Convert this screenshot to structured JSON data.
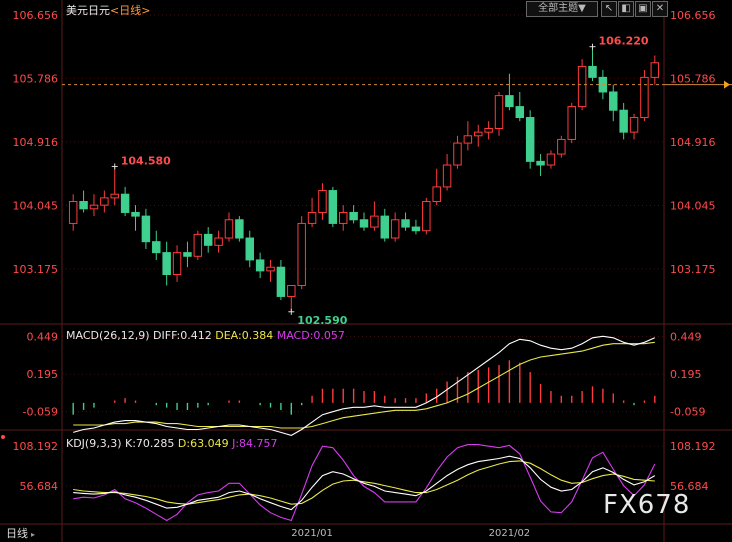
{
  "header": {
    "title": "美元日元",
    "period": "<日线>",
    "theme_button": "全部主题▼",
    "colors": {
      "title": "#e8e8e8",
      "period": "#ff9a3a"
    }
  },
  "macd_header": {
    "name": "MACD(26,12,9)",
    "diff": "DIFF:0.412",
    "dea": "DEA:0.384",
    "macd": "MACD:0.057"
  },
  "kdj_header": {
    "name": "KDJ(9,3,3)",
    "k": "K:70.285",
    "d": "D:63.049",
    "j": "J:84.757"
  },
  "bottom_tab": {
    "label": "日线"
  },
  "watermark": "FX678",
  "colors": {
    "up": "#ff3b3b",
    "down": "#3fcf8e",
    "axis_up": "#ff4b4b",
    "axis_green": "#3fcf8e",
    "diff": "#ffffff",
    "dea": "#e8e84a",
    "jline": "#d63cf0",
    "grid": "#3a1010",
    "dash": "#d08a3a"
  },
  "chart_data": [
    {
      "type": "candlestick",
      "y_ticks": [
        "106.656",
        "105.786",
        "104.916",
        "104.045",
        "103.175"
      ],
      "ylim": [
        102.45,
        106.75
      ],
      "x_labels": [
        "2021/01",
        "2021/02"
      ],
      "annotations": {
        "high": "106.220",
        "high_left": "104.580",
        "low": "102.590"
      },
      "candles": [
        {
          "o": 103.8,
          "h": 104.2,
          "l": 103.7,
          "c": 104.1
        },
        {
          "o": 104.1,
          "h": 104.25,
          "l": 103.95,
          "c": 104.0
        },
        {
          "o": 104.0,
          "h": 104.2,
          "l": 103.9,
          "c": 104.05
        },
        {
          "o": 104.05,
          "h": 104.25,
          "l": 103.95,
          "c": 104.15
        },
        {
          "o": 104.15,
          "h": 104.58,
          "l": 104.05,
          "c": 104.2
        },
        {
          "o": 104.2,
          "h": 104.3,
          "l": 103.9,
          "c": 103.95
        },
        {
          "o": 103.95,
          "h": 104.05,
          "l": 103.7,
          "c": 103.9
        },
        {
          "o": 103.9,
          "h": 104.0,
          "l": 103.45,
          "c": 103.55
        },
        {
          "o": 103.55,
          "h": 103.7,
          "l": 103.3,
          "c": 103.4
        },
        {
          "o": 103.4,
          "h": 103.55,
          "l": 102.95,
          "c": 103.1
        },
        {
          "o": 103.1,
          "h": 103.5,
          "l": 103.0,
          "c": 103.4
        },
        {
          "o": 103.4,
          "h": 103.55,
          "l": 103.2,
          "c": 103.35
        },
        {
          "o": 103.35,
          "h": 103.7,
          "l": 103.3,
          "c": 103.65
        },
        {
          "o": 103.65,
          "h": 103.75,
          "l": 103.4,
          "c": 103.5
        },
        {
          "o": 103.5,
          "h": 103.7,
          "l": 103.4,
          "c": 103.6
        },
        {
          "o": 103.6,
          "h": 103.95,
          "l": 103.55,
          "c": 103.85
        },
        {
          "o": 103.85,
          "h": 103.9,
          "l": 103.55,
          "c": 103.6
        },
        {
          "o": 103.6,
          "h": 103.7,
          "l": 103.2,
          "c": 103.3
        },
        {
          "o": 103.3,
          "h": 103.4,
          "l": 103.05,
          "c": 103.15
        },
        {
          "o": 103.15,
          "h": 103.3,
          "l": 103.0,
          "c": 103.2
        },
        {
          "o": 103.2,
          "h": 103.3,
          "l": 102.75,
          "c": 102.8
        },
        {
          "o": 102.8,
          "h": 102.95,
          "l": 102.59,
          "c": 102.95
        },
        {
          "o": 102.95,
          "h": 103.9,
          "l": 102.9,
          "c": 103.8
        },
        {
          "o": 103.8,
          "h": 104.15,
          "l": 103.75,
          "c": 103.95
        },
        {
          "o": 103.95,
          "h": 104.35,
          "l": 103.85,
          "c": 104.25
        },
        {
          "o": 104.25,
          "h": 104.3,
          "l": 103.75,
          "c": 103.8
        },
        {
          "o": 103.8,
          "h": 104.05,
          "l": 103.7,
          "c": 103.95
        },
        {
          "o": 103.95,
          "h": 104.05,
          "l": 103.8,
          "c": 103.85
        },
        {
          "o": 103.85,
          "h": 103.95,
          "l": 103.7,
          "c": 103.75
        },
        {
          "o": 103.75,
          "h": 104.1,
          "l": 103.7,
          "c": 103.9
        },
        {
          "o": 103.9,
          "h": 104.0,
          "l": 103.55,
          "c": 103.6
        },
        {
          "o": 103.6,
          "h": 103.95,
          "l": 103.55,
          "c": 103.85
        },
        {
          "o": 103.85,
          "h": 103.95,
          "l": 103.7,
          "c": 103.75
        },
        {
          "o": 103.75,
          "h": 103.85,
          "l": 103.65,
          "c": 103.7
        },
        {
          "o": 103.7,
          "h": 104.15,
          "l": 103.65,
          "c": 104.1
        },
        {
          "o": 104.1,
          "h": 104.55,
          "l": 104.05,
          "c": 104.3
        },
        {
          "o": 104.3,
          "h": 104.75,
          "l": 104.25,
          "c": 104.6
        },
        {
          "o": 104.6,
          "h": 105.0,
          "l": 104.55,
          "c": 104.9
        },
        {
          "o": 104.9,
          "h": 105.2,
          "l": 104.8,
          "c": 105.0
        },
        {
          "o": 105.0,
          "h": 105.15,
          "l": 104.85,
          "c": 105.05
        },
        {
          "o": 105.05,
          "h": 105.2,
          "l": 104.95,
          "c": 105.1
        },
        {
          "o": 105.1,
          "h": 105.6,
          "l": 105.0,
          "c": 105.55
        },
        {
          "o": 105.55,
          "h": 105.85,
          "l": 105.35,
          "c": 105.4
        },
        {
          "o": 105.4,
          "h": 105.6,
          "l": 105.2,
          "c": 105.25
        },
        {
          "o": 105.25,
          "h": 105.35,
          "l": 104.55,
          "c": 104.65
        },
        {
          "o": 104.65,
          "h": 104.75,
          "l": 104.45,
          "c": 104.6
        },
        {
          "o": 104.6,
          "h": 104.8,
          "l": 104.55,
          "c": 104.75
        },
        {
          "o": 104.75,
          "h": 105.0,
          "l": 104.7,
          "c": 104.95
        },
        {
          "o": 104.95,
          "h": 105.45,
          "l": 104.9,
          "c": 105.4
        },
        {
          "o": 105.4,
          "h": 106.05,
          "l": 105.35,
          "c": 105.95
        },
        {
          "o": 105.95,
          "h": 106.22,
          "l": 105.75,
          "c": 105.8
        },
        {
          "o": 105.8,
          "h": 105.9,
          "l": 105.5,
          "c": 105.6
        },
        {
          "o": 105.6,
          "h": 105.7,
          "l": 105.2,
          "c": 105.35
        },
        {
          "o": 105.35,
          "h": 105.45,
          "l": 104.95,
          "c": 105.05
        },
        {
          "o": 105.05,
          "h": 105.3,
          "l": 104.95,
          "c": 105.25
        },
        {
          "o": 105.25,
          "h": 105.9,
          "l": 105.2,
          "c": 105.8
        },
        {
          "o": 105.8,
          "h": 106.1,
          "l": 105.7,
          "c": 106.0
        }
      ]
    },
    {
      "type": "macd",
      "y_ticks": [
        "0.449",
        "0.195",
        "-0.059"
      ],
      "ylim": [
        -0.17,
        0.52
      ],
      "diff": [
        -0.2,
        -0.18,
        -0.17,
        -0.15,
        -0.13,
        -0.12,
        -0.12,
        -0.13,
        -0.14,
        -0.16,
        -0.17,
        -0.18,
        -0.18,
        -0.17,
        -0.16,
        -0.15,
        -0.15,
        -0.16,
        -0.17,
        -0.18,
        -0.2,
        -0.22,
        -0.18,
        -0.13,
        -0.08,
        -0.06,
        -0.04,
        -0.03,
        -0.03,
        -0.02,
        -0.03,
        -0.03,
        -0.03,
        -0.03,
        0.0,
        0.04,
        0.09,
        0.14,
        0.19,
        0.24,
        0.29,
        0.34,
        0.4,
        0.43,
        0.42,
        0.39,
        0.37,
        0.36,
        0.37,
        0.4,
        0.44,
        0.45,
        0.44,
        0.41,
        0.39,
        0.41,
        0.44
      ],
      "dea": [
        -0.15,
        -0.15,
        -0.15,
        -0.15,
        -0.14,
        -0.14,
        -0.13,
        -0.13,
        -0.13,
        -0.14,
        -0.14,
        -0.15,
        -0.16,
        -0.16,
        -0.16,
        -0.16,
        -0.16,
        -0.16,
        -0.16,
        -0.16,
        -0.17,
        -0.17,
        -0.17,
        -0.16,
        -0.14,
        -0.12,
        -0.1,
        -0.09,
        -0.08,
        -0.07,
        -0.06,
        -0.05,
        -0.05,
        -0.05,
        -0.04,
        -0.02,
        0.0,
        0.03,
        0.06,
        0.1,
        0.14,
        0.18,
        0.22,
        0.26,
        0.29,
        0.31,
        0.32,
        0.33,
        0.34,
        0.35,
        0.37,
        0.39,
        0.4,
        0.4,
        0.4,
        0.4,
        0.41
      ],
      "hist": [
        -0.05,
        -0.03,
        -0.02,
        0.0,
        0.01,
        0.02,
        0.01,
        0.0,
        -0.01,
        -0.02,
        -0.03,
        -0.03,
        -0.02,
        -0.01,
        0.0,
        0.01,
        0.01,
        0.0,
        -0.01,
        -0.02,
        -0.03,
        -0.05,
        -0.01,
        0.03,
        0.06,
        0.06,
        0.06,
        0.06,
        0.05,
        0.05,
        0.03,
        0.02,
        0.02,
        0.02,
        0.04,
        0.06,
        0.09,
        0.11,
        0.13,
        0.14,
        0.15,
        0.16,
        0.18,
        0.17,
        0.13,
        0.08,
        0.05,
        0.03,
        0.03,
        0.05,
        0.07,
        0.06,
        0.04,
        0.01,
        -0.01,
        0.01,
        0.03
      ]
    },
    {
      "type": "kdj",
      "y_ticks": [
        "108.192",
        "56.684"
      ],
      "ylim": [
        10,
        125
      ],
      "k": [
        48,
        47,
        46,
        47,
        49,
        45,
        42,
        38,
        33,
        28,
        29,
        33,
        38,
        40,
        42,
        48,
        50,
        46,
        40,
        35,
        30,
        26,
        38,
        55,
        70,
        75,
        72,
        66,
        60,
        56,
        50,
        48,
        46,
        44,
        50,
        60,
        70,
        78,
        84,
        88,
        90,
        92,
        95,
        92,
        80,
        65,
        55,
        50,
        52,
        62,
        75,
        80,
        74,
        65,
        58,
        62,
        70
      ],
      "d": [
        52,
        50,
        49,
        48,
        48,
        47,
        45,
        43,
        40,
        36,
        34,
        33,
        35,
        37,
        39,
        42,
        45,
        46,
        44,
        41,
        37,
        33,
        34,
        41,
        51,
        59,
        63,
        64,
        62,
        60,
        57,
        54,
        51,
        48,
        48,
        52,
        58,
        64,
        71,
        77,
        81,
        85,
        88,
        89,
        86,
        79,
        71,
        64,
        60,
        61,
        66,
        70,
        72,
        69,
        65,
        64,
        63
      ],
      "j": [
        40,
        42,
        41,
        45,
        52,
        40,
        35,
        28,
        20,
        12,
        20,
        35,
        45,
        48,
        50,
        60,
        60,
        46,
        32,
        22,
        16,
        12,
        46,
        83,
        108,
        106,
        90,
        70,
        56,
        48,
        36,
        36,
        36,
        36,
        54,
        76,
        94,
        106,
        110,
        110,
        108,
        106,
        109,
        98,
        68,
        37,
        23,
        22,
        36,
        64,
        93,
        100,
        78,
        57,
        44,
        58,
        85
      ]
    }
  ]
}
